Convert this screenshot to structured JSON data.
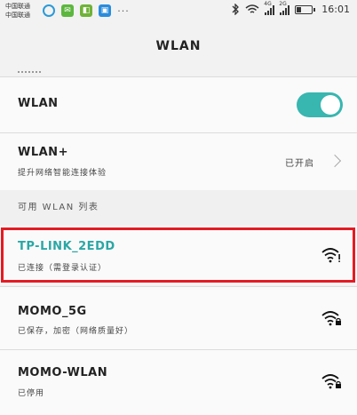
{
  "status_bar": {
    "carrier_1": "中国联通",
    "carrier_2": "中国联通",
    "more": "···",
    "network_1": "4G",
    "network_2": "2G",
    "time": "16:01"
  },
  "header": {
    "title": "WLAN"
  },
  "settings": {
    "wlan": {
      "label": "WLAN",
      "enabled": true
    },
    "wlan_plus": {
      "label": "WLAN+",
      "description": "提升网络智能连接体验",
      "status": "已开启"
    }
  },
  "available_section": {
    "title": "可用 WLAN 列表"
  },
  "networks": [
    {
      "ssid": "TP-LINK_2EDD",
      "status": "已连接（需登录认证）",
      "connected": true
    },
    {
      "ssid": "MOMO_5G",
      "status": "已保存，加密（网络质量好）",
      "connected": false
    },
    {
      "ssid": "MOMO-WLAN",
      "status": "已停用",
      "connected": false
    }
  ],
  "colors": {
    "accent": "#2aa7a5",
    "toggle": "#38b6b0",
    "highlight": "#e31b23"
  }
}
